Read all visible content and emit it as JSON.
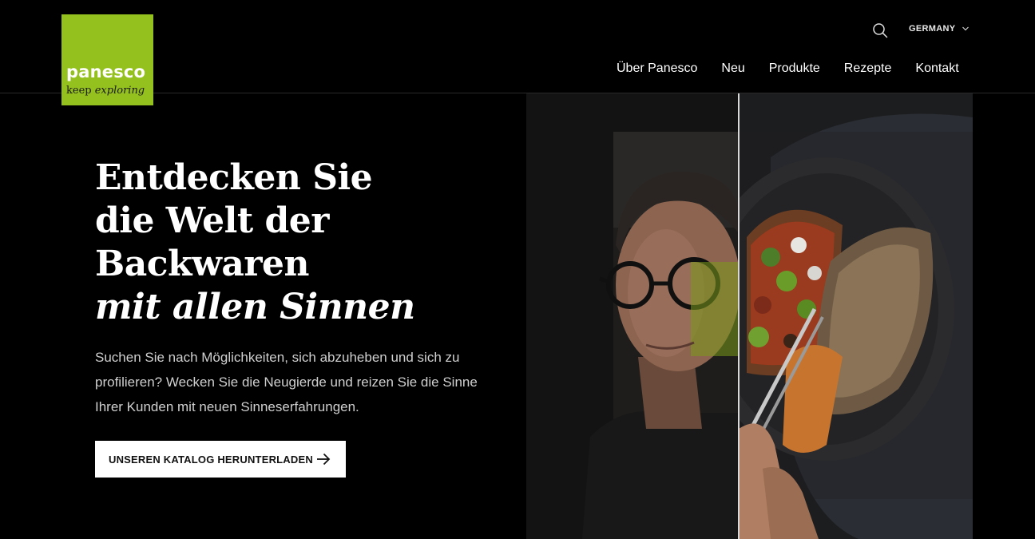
{
  "brand": {
    "name": "panesco",
    "tagline_prefix": "keep",
    "tagline_italic": "exploring",
    "color": "#95c11f"
  },
  "header": {
    "search_icon": "search-icon",
    "country": "GERMANY"
  },
  "nav": {
    "items": [
      {
        "label": "Über Panesco"
      },
      {
        "label": "Neu"
      },
      {
        "label": "Produkte"
      },
      {
        "label": "Rezepte"
      },
      {
        "label": "Kontakt"
      }
    ]
  },
  "hero": {
    "title_lines": [
      "Entdecken Sie",
      "die Welt der",
      "Backwaren"
    ],
    "title_italic": "mit allen Sinnen",
    "description": "Suchen Sie nach Möglichkeiten, sich abzuheben und sich zu profilieren? Wecken Sie die Neugierde und reizen Sie die Sinne Ihrer Kunden mit neuen Sinneserfahrungen.",
    "cta_label": "UNSEREN KATALOG HERUNTERLADEN",
    "cta_icon": "arrow-right-icon"
  }
}
